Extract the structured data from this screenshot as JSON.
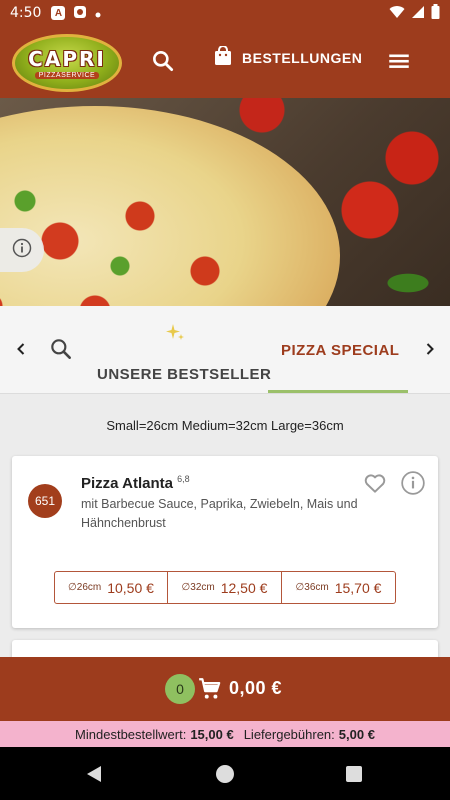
{
  "status_bar": {
    "time": "4:50",
    "notif_a": "A"
  },
  "header": {
    "logo_text": "CAPRI",
    "logo_sub": "PIZZASERVICE",
    "orders_label": "BESTELLUNGEN"
  },
  "categories": {
    "bestseller_label": "UNSERE BESTSELLER",
    "special_label": "PIZZA SPECIAL"
  },
  "sizes_note": "Small=26cm Medium=32cm Large=36cm",
  "product": {
    "number": "651",
    "name": "Pizza Atlanta",
    "allergens": "6,8",
    "description": "mit Barbecue Sauce, Paprika, Zwiebeln, Mais und Hähnchenbrust",
    "prices": [
      {
        "size": "∅26cm",
        "amount": "10,50 €"
      },
      {
        "size": "∅32cm",
        "amount": "12,50 €"
      },
      {
        "size": "∅36cm",
        "amount": "15,70 €"
      }
    ]
  },
  "cart": {
    "count": "0",
    "total": "0,00 €"
  },
  "footer": {
    "min_label": "Mindestbestellwert:",
    "min_value": "15,00 €",
    "fee_label": "Liefergebühren:",
    "fee_value": "5,00 €"
  },
  "colors": {
    "brand": "#9d3c1d",
    "accent_green": "#8fc060",
    "min_bar": "#f4b3cd"
  },
  "icons": [
    "search-icon",
    "shopping-bag-icon",
    "menu-icon",
    "info-icon",
    "chevron-left-icon",
    "sparkle-icon",
    "chevron-right-icon",
    "heart-icon",
    "cart-icon"
  ]
}
